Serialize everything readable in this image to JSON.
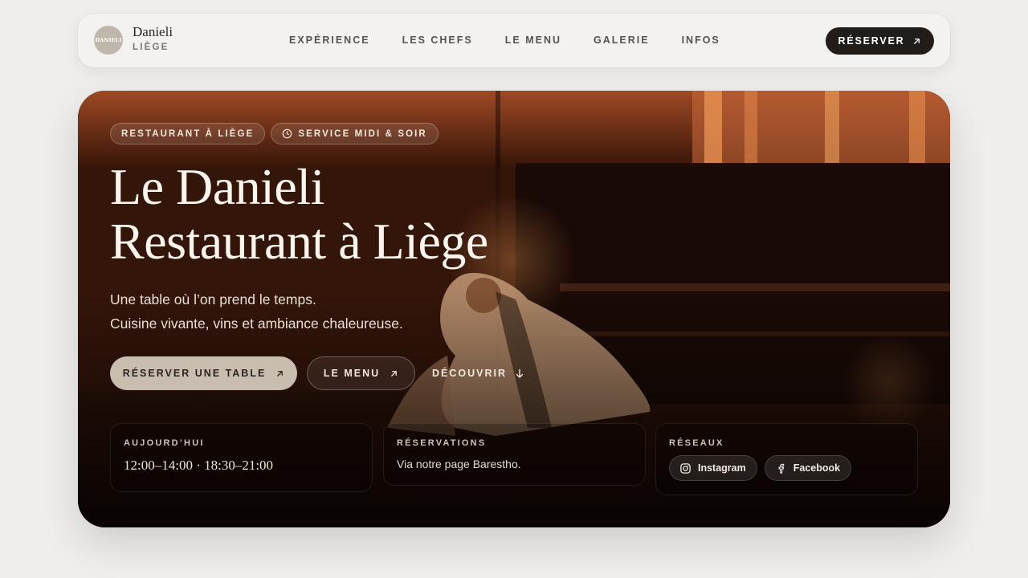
{
  "brand": {
    "logo_text": "DANIELI",
    "name": "Danieli",
    "city": "LIÈGE"
  },
  "nav": {
    "links": [
      "EXPÉRIENCE",
      "LES CHEFS",
      "LE MENU",
      "GALERIE",
      "INFOS"
    ],
    "cta_label": "RÉSERVER"
  },
  "hero": {
    "tags": [
      {
        "label": "RESTAURANT À LIÈGE",
        "icon": null
      },
      {
        "label": "SERVICE MIDI & SOIR",
        "icon": "clock-icon"
      }
    ],
    "title_lines": [
      "Le Danieli",
      "Restaurant à Liège"
    ],
    "subtitle_lines": [
      "Une table où l’on prend le temps.",
      "Cuisine vivante, vins et ambiance chaleureuse."
    ],
    "primary_button": "RÉSERVER UNE TABLE",
    "outline_button": "LE MENU",
    "link_button": "DÉCOUVRIR"
  },
  "cards": {
    "today": {
      "label": "AUJOURD’HUI",
      "hours": "12:00–14:00 · 18:30–21:00"
    },
    "reservations": {
      "label": "RÉSERVATIONS",
      "text": "Via notre page Barestho."
    },
    "social": {
      "label": "RÉSEAUX",
      "items": [
        {
          "name": "Instagram",
          "icon": "instagram-icon"
        },
        {
          "name": "Facebook",
          "icon": "facebook-icon"
        }
      ]
    }
  },
  "colors": {
    "page_bg": "#efeeec",
    "nav_bg": "#f3f2f0",
    "cta_dark": "#221d19",
    "primary_button_bg": "#c9bdaf",
    "hero_warm": "#2a120a"
  }
}
